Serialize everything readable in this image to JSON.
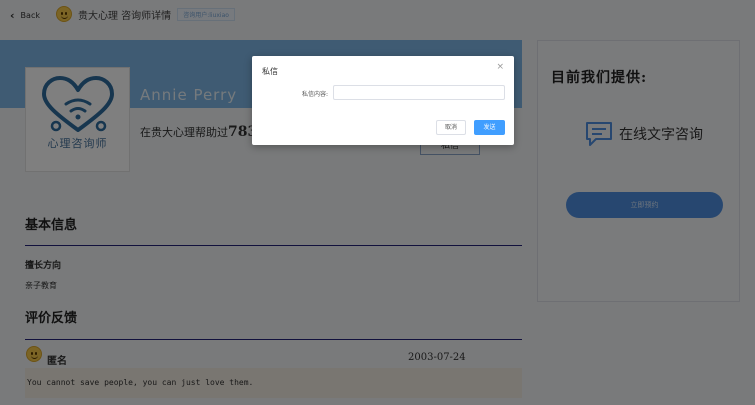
{
  "header": {
    "back_label": "Back",
    "brand_title": "贵大心理 咨询师详情",
    "user_tag": "咨询用户:liuxiao"
  },
  "profile": {
    "avatar_caption": "心理咨询师",
    "name": "Annie Perry",
    "helped_prefix": "在贵大心理帮助过",
    "helped_count": "783",
    "action_label": "私信"
  },
  "basic_info": {
    "title": "基本信息",
    "specialty_label": "擅长方向",
    "specialty_value": "亲子教育"
  },
  "reviews": {
    "title": "评价反馈",
    "items": [
      {
        "author": "匿名",
        "date": "2003-07-24",
        "text": "You cannot save people, you can just love them."
      }
    ]
  },
  "side": {
    "title": "目前我们提供:",
    "service_label": "在线文字咨询",
    "book_label": "立即预约"
  },
  "dialog": {
    "title": "私信",
    "field_label": "私信内容:",
    "field_value": "",
    "field_placeholder": "",
    "cancel_label": "取消",
    "send_label": "发送",
    "close_glyph": "×"
  },
  "colors": {
    "banner": "#7fb6e6",
    "accent": "#409eff",
    "rule": "#24237b",
    "book_button": "#4f8fe0"
  }
}
